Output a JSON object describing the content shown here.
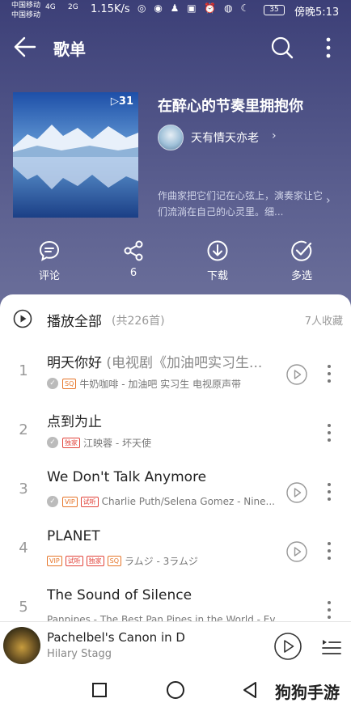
{
  "status_bar": {
    "carrier_1": "中国移动",
    "carrier_2": "中国移动",
    "signal_1": "4G",
    "signal_2": "2G",
    "speed": "1.15K/s",
    "battery": "35",
    "time": "傍晚5:13"
  },
  "app_bar": {
    "title": "歌单"
  },
  "playlist": {
    "cover_count": "▷31",
    "name": "在醉心的节奏里拥抱你",
    "creator": "天有情天亦老",
    "description": "作曲家把它们记在心弦上，演奏家让它们流淌在自己的心灵里。细..."
  },
  "actions": [
    {
      "label": "评论",
      "icon": "comment-icon"
    },
    {
      "label": "6",
      "icon": "share-icon"
    },
    {
      "label": "下载",
      "icon": "download-icon"
    },
    {
      "label": "多选",
      "icon": "multiselect-icon"
    }
  ],
  "play_all": {
    "label": "播放全部",
    "count": "(共226首)",
    "collect": "7人收藏"
  },
  "songs": [
    {
      "index": "1",
      "title": "明天你好",
      "extra": " (电视剧《加油吧实习生...",
      "subtitle": "牛奶咖啡 - 加油吧 实习生 电视原声带"
    },
    {
      "index": "2",
      "title": "点到为止",
      "extra": "",
      "subtitle": "江映蓉 - 坏天使"
    },
    {
      "index": "3",
      "title": "We Don't Talk Anymore",
      "extra": "",
      "subtitle": "Charlie Puth/Selena Gomez - Nine..."
    },
    {
      "index": "4",
      "title": "PLANET",
      "extra": "",
      "subtitle": "ラムジ - 3ラムジ"
    },
    {
      "index": "5",
      "title": "The Sound of Silence",
      "extra": "",
      "subtitle": "Panpipes - The Best Pan Pipes in the World - Ever!"
    }
  ],
  "tags": {
    "sq": "SQ",
    "exclusive": "独家",
    "vip": "VIP",
    "trial": "试听"
  },
  "now_playing": {
    "title": "Pachelbel's Canon in D",
    "artist": "Hilary Stagg"
  },
  "watermark": "狗狗手游",
  "colors": {
    "hero_top": "#3c3f77",
    "hero_bottom": "#6b6f9a",
    "tag_orange": "#e6762a",
    "tag_red": "#e2453c"
  }
}
